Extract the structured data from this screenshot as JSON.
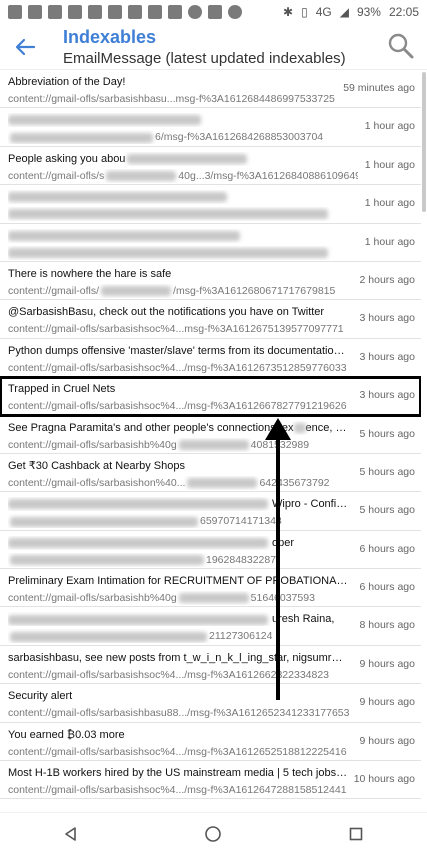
{
  "status_bar": {
    "signal": "4G",
    "battery": "93%",
    "time": "22:05"
  },
  "app_bar": {
    "title": "Indexables",
    "subtitle": "EmailMessage (latest updated indexables)"
  },
  "rows": [
    {
      "title": "Abbreviation of the Day!",
      "path": "content://gmail-ofls/sarbasishbasu...msg-f%3A1612684486997533725",
      "time": "59 minutes ago",
      "blurred": false
    },
    {
      "title": "",
      "path": "",
      "path_tail": "6/msg-f%3A1612684268853003704",
      "time": "1 hour ago",
      "blurred": true
    },
    {
      "title": "People asking you abou",
      "path": "content://gmail-ofls/s",
      "path_tail": "40g...3/msg-f%3A1612684088610964943",
      "time": "1 hour ago",
      "blurred": "partial"
    },
    {
      "title": "",
      "path": "",
      "time": "1 hour ago",
      "blurred": true
    },
    {
      "title": "",
      "path": "",
      "time": "1 hour ago",
      "blurred": true
    },
    {
      "title": "There is nowhere the hare is safe",
      "path": "content://gmail-ofls/",
      "path_tail": "/msg-f%3A1612680671717679815",
      "time": "2 hours ago",
      "blurred": "partial"
    },
    {
      "title": "@SarbasishBasu, check out the notifications you have on Twitter",
      "path": "content://gmail-ofls/sarbasishsoc%4...msg-f%3A1612675139577097771",
      "time": "3 hours ago",
      "blurred": false
    },
    {
      "title": "Python dumps offensive 'master/slave' terms from its documentation | Ho...",
      "path": "content://gmail-ofls/sarbasishsoc%4.../msg-f%3A1612673512859776033",
      "time": "3 hours ago",
      "blurred": false
    },
    {
      "title": "Trapped in Cruel Nets",
      "path": "content://gmail-ofls/sarbasishsoc%4.../msg-f%3A1612667827791219626",
      "time": "3 hours ago",
      "blurred": false,
      "highlighted": true
    },
    {
      "title": "See Pragna Paramita's and other people's connections, ex",
      "title_tail": "ence, and m",
      "path": "content://gmail-ofls/sarbasishb%40g",
      "path_tail": "4081532989",
      "time": "5 hours ago",
      "blurred": "partial"
    },
    {
      "title": "Get ₹30 Cashback at Nearby Shops",
      "path": "content://gmail-ofls/sarbasishon%40...",
      "path_tail": "642435673792",
      "time": "5 hours ago",
      "blurred": "partial"
    },
    {
      "title": "",
      "title_tail": "Wipro - Confirm...",
      "path": "",
      "path_tail": "65970714171343",
      "time": "5 hours ago",
      "blurred": true
    },
    {
      "title": "",
      "title_tail": "oper",
      "path": "",
      "path_tail": "196284832287",
      "time": "6 hours ago",
      "blurred": true
    },
    {
      "title": "Preliminary Exam Intimation for RECRUITMENT OF PROBATIONARY OFFI...",
      "path": "content://gmail-ofls/sarbasishb%40g",
      "path_tail": "51646037593",
      "time": "6 hours ago",
      "blurred": "partial"
    },
    {
      "title": "",
      "title_tail": "uresh Raina,",
      "path": "",
      "path_tail": "21127306124",
      "time": "8 hours ago",
      "blurred": true
    },
    {
      "title": "sarbasishbasu, see new posts from t_w_i_n_k_l_ing_star, nigsumrudra, azi...",
      "path": "content://gmail-ofls/sarbasishsoc%4.../msg-f%3A1612662322334823",
      "time": "9 hours ago",
      "blurred": false
    },
    {
      "title": "Security alert",
      "path": "content://gmail-ofls/sarbasishbasu88.../msg-f%3A1612652341233177653",
      "time": "9 hours ago",
      "blurred": false
    },
    {
      "title": "You earned ₿0.03 more",
      "path": "content://gmail-ofls/sarbasishsoc%4.../msg-f%3A1612652518812225416",
      "time": "9 hours ago",
      "blurred": false
    },
    {
      "title": "Most H-1B workers hired by the US mainstream media | 5 tech jobs that...",
      "path": "content://gmail-ofls/sarbasishsoc%4.../msg-f%3A1612647288158512441",
      "time": "10 hours ago",
      "blurred": false
    }
  ],
  "colors": {
    "accent": "#3f7fd6",
    "highlight_border": "#000000"
  },
  "icons": {
    "back": "arrow-left-icon",
    "search": "search-icon",
    "nav_back": "triangle-back-icon",
    "nav_home": "circle-home-icon",
    "nav_recents": "square-recents-icon"
  }
}
